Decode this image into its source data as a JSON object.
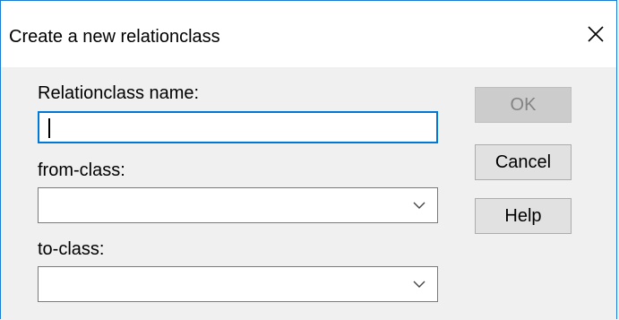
{
  "window": {
    "title": "Create a new relationclass",
    "close_glyph": "✕"
  },
  "form": {
    "name_label": "Relationclass name:",
    "name_value": "",
    "from_label": "from-class:",
    "from_value": "",
    "to_label": "to-class:",
    "to_value": ""
  },
  "buttons": {
    "ok": "OK",
    "cancel": "Cancel",
    "help": "Help"
  },
  "colors": {
    "focus_border": "#0078d7",
    "window_border": "#1a7fd4",
    "background": "#f0f0f0"
  },
  "icons": {
    "close": "close-icon",
    "dropdown": "chevron-down-icon"
  }
}
